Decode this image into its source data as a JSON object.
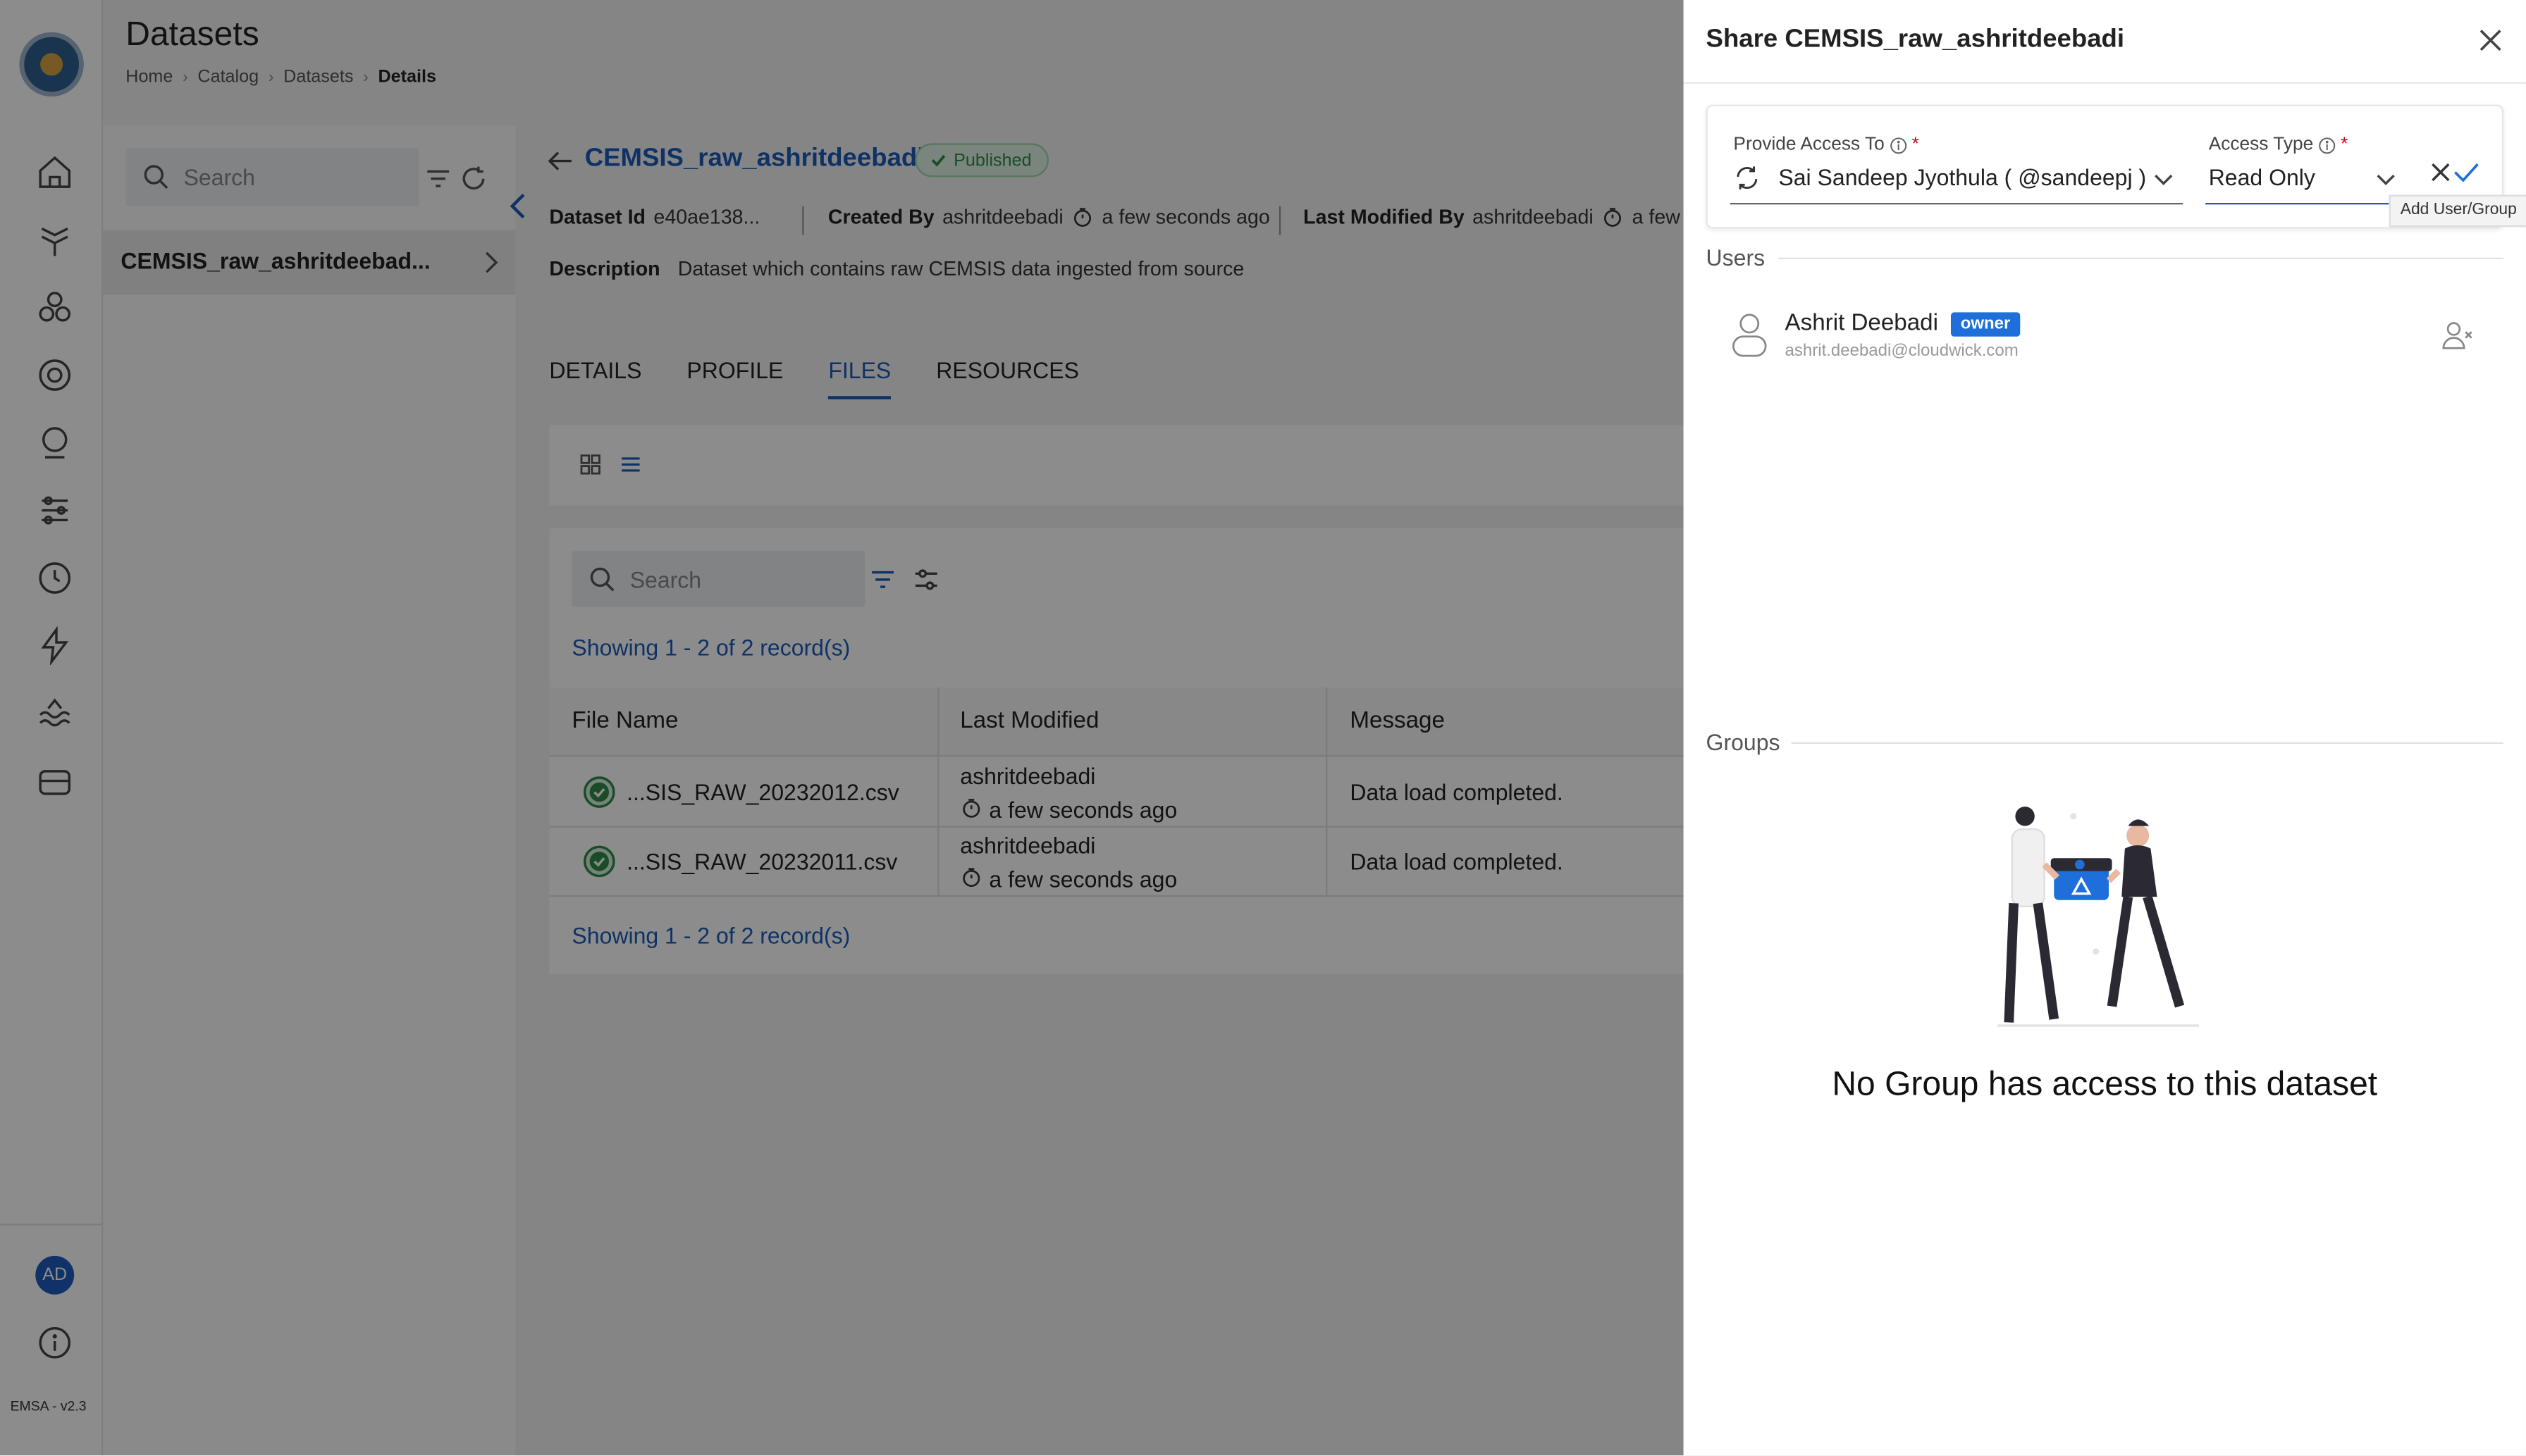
{
  "app": {
    "page_title": "Datasets",
    "breadcrumbs": [
      "Home",
      "Catalog",
      "Datasets",
      "Details"
    ],
    "version": "EMSA - v2.3",
    "user_initials": "AD"
  },
  "left_panel": {
    "search_placeholder": "Search",
    "dataset_item": "CEMSIS_raw_ashritdeebad..."
  },
  "dataset": {
    "name": "CEMSIS_raw_ashritdeebadi",
    "status": "Published",
    "id_label": "Dataset Id",
    "id_value": "e40ae138...",
    "created_by_label": "Created By",
    "created_by": "ashritdeebadi",
    "created_time": "a few seconds ago",
    "modified_by_label": "Last Modified By",
    "modified_by": "ashritdeebadi",
    "modified_time": "a few se",
    "description_label": "Description",
    "description": "Dataset which contains raw CEMSIS data ingested from source"
  },
  "tabs": [
    "DETAILS",
    "PROFILE",
    "FILES",
    "RESOURCES"
  ],
  "active_tab": "FILES",
  "files": {
    "search_placeholder": "Search",
    "showing_text": "Showing 1 - 2 of 2 record(s)",
    "columns": [
      "File Name",
      "Last Modified",
      "Message"
    ],
    "rows": [
      {
        "file_name": "...SIS_RAW_20232012.csv",
        "modified_by": "ashritdeebadi",
        "modified_time": "a few seconds ago",
        "message": "Data load completed."
      },
      {
        "file_name": "...SIS_RAW_20232011.csv",
        "modified_by": "ashritdeebadi",
        "modified_time": "a few seconds ago",
        "message": "Data load completed."
      }
    ]
  },
  "share_drawer": {
    "title": "Share CEMSIS_raw_ashritdeebadi",
    "provide_access_label": "Provide Access To",
    "provide_access_value": "Sai Sandeep Jyothula ( @sandeepj )",
    "access_type_label": "Access Type",
    "access_type_value": "Read Only",
    "required_mark": "*",
    "tooltip": "Add User/Group",
    "users_label": "Users",
    "user_name": "Ashrit Deebadi",
    "user_role": "owner",
    "user_email": "ashrit.deebadi@cloudwick.com",
    "groups_label": "Groups",
    "empty_groups_message": "No Group has access to this dataset"
  },
  "colors": {
    "accent": "#1a5cb8",
    "success": "#2e8b47",
    "owner_badge": "#1e6fd9",
    "required": "#d0021b"
  }
}
